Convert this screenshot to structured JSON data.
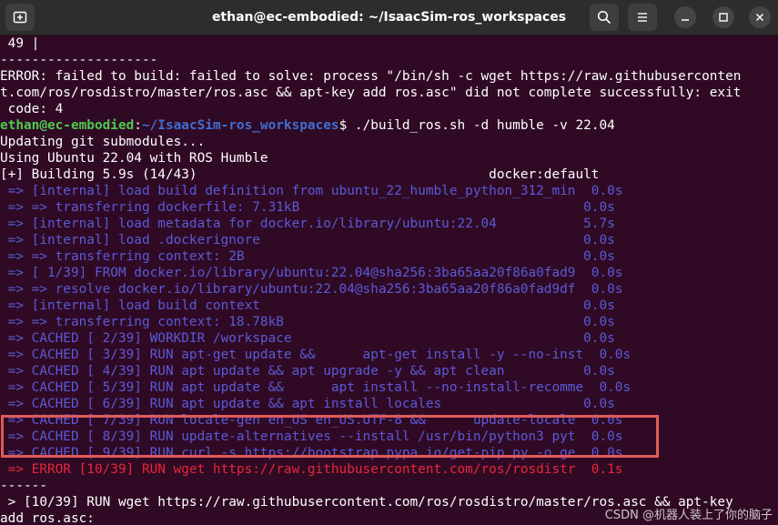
{
  "window": {
    "title": "ethan@ec-embodied: ~/IsaacSim-ros_workspaces"
  },
  "icons": {
    "new_tab": "new-tab-icon",
    "search": "search-icon",
    "menu": "menu-icon",
    "minimize": "minimize-icon",
    "maximize": "maximize-icon",
    "close": "close-icon"
  },
  "terminal": {
    "lines": [
      " 49 |",
      "--------------------",
      "ERROR: failed to build: failed to solve: process \"/bin/sh -c wget https://raw.githubuserconten",
      "t.com/ros/rosdistro/master/ros.asc && apt-key add ros.asc\" did not complete successfully: exit",
      " code: 4"
    ],
    "prompt": {
      "user": "ethan@ec-embodied",
      "sep": ":",
      "path": "~/IsaacSim-ros_workspaces",
      "symbol": "$ ",
      "command": "./build_ros.sh -d humble -v 22.04"
    },
    "after_prompt": [
      "Updating git submodules...",
      "Using Ubuntu 22.04 with ROS Humble",
      "[+] Building 5.9s (14/43)                                     docker:default"
    ],
    "build_steps": [
      " => [internal] load build definition from ubuntu_22_humble_python_312_min  0.0s",
      " => => transferring dockerfile: 7.31kB                                    0.0s",
      " => [internal] load metadata for docker.io/library/ubuntu:22.04           5.7s",
      " => [internal] load .dockerignore                                         0.0s",
      " => => transferring context: 2B                                           0.0s",
      " => [ 1/39] FROM docker.io/library/ubuntu:22.04@sha256:3ba65aa20f86a0fad9  0.0s",
      " => => resolve docker.io/library/ubuntu:22.04@sha256:3ba65aa20f86a0fad9df  0.0s",
      " => [internal] load build context                                         0.0s",
      " => => transferring context: 18.78kB                                      0.0s",
      " => CACHED [ 2/39] WORKDIR /workspace                                     0.0s",
      " => CACHED [ 3/39] RUN apt-get update &&      apt-get install -y --no-inst  0.0s",
      " => CACHED [ 4/39] RUN apt update && apt upgrade -y && apt clean          0.0s",
      " => CACHED [ 5/39] RUN apt update &&      apt install --no-install-recomme  0.0s",
      " => CACHED [ 6/39] RUN apt update && apt install locales                  0.0s",
      " => CACHED [ 7/39] RUN locale-gen en_US en_US.UTF-8 &&      update-locale  0.0s",
      " => CACHED [ 8/39] RUN update-alternatives --install /usr/bin/python3 pyt  0.0s",
      " => CACHED [ 9/39] RUN curl -s https://bootstrap.pypa.io/get-pip.py -o ge  0.0s"
    ],
    "error_step": " => ERROR [10/39] RUN wget https://raw.githubusercontent.com/ros/rosdistr  0.1s",
    "tail": [
      "------",
      " > [10/39] RUN wget https://raw.githubusercontent.com/ros/rosdistro/master/ros.asc && apt-key",
      "add ros.asc:"
    ]
  },
  "watermark": "CSDN @机器人装上了你的脑子",
  "colors": {
    "background": "#300a24",
    "step_text": "#5a5ad8",
    "error_text": "#e8273a",
    "user_green": "#4ec94e",
    "path_blue": "#3f6fd6",
    "highlight_box": "#e05a5a"
  }
}
